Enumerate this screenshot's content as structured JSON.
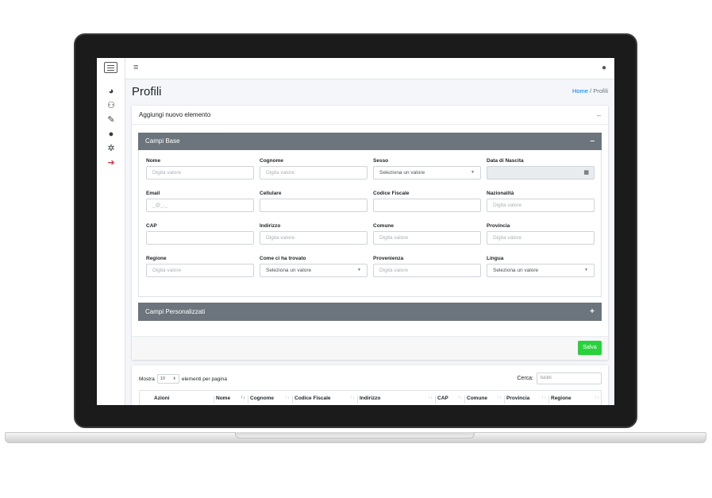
{
  "nav": {
    "menu_icon": "hamburger-icon",
    "chat_icon": "comments-icon",
    "sidebar_icons": [
      "chart-pie-icon",
      "users-icon",
      "edit-icon",
      "comments-icon",
      "cog-icon",
      "sign-out-icon"
    ]
  },
  "page": {
    "title": "Profili",
    "breadcrumb_home": "Home",
    "breadcrumb_sep": "/",
    "breadcrumb_current": "Profili"
  },
  "card": {
    "title": "Aggiungi nuovo elemento",
    "collapse": "–"
  },
  "section_base": {
    "title": "Campi Base",
    "toggle": "–",
    "fields": [
      {
        "label": "Nome",
        "value": "",
        "placeholder": "Digita valore",
        "type": "text"
      },
      {
        "label": "Cognome",
        "value": "",
        "placeholder": "Digita valore",
        "type": "text"
      },
      {
        "label": "Sesso",
        "value": "Seleziona un valore",
        "placeholder": "",
        "type": "select"
      },
      {
        "label": "Data di Nascita",
        "value": "",
        "placeholder": "",
        "type": "date"
      },
      {
        "label": "Email",
        "value": "",
        "placeholder": "_@_._",
        "type": "text"
      },
      {
        "label": "Cellulare",
        "value": "",
        "placeholder": "",
        "type": "text"
      },
      {
        "label": "Codice Fiscale",
        "value": "",
        "placeholder": "",
        "type": "text"
      },
      {
        "label": "Nazionalità",
        "value": "",
        "placeholder": "Digita valore",
        "type": "text"
      },
      {
        "label": "CAP",
        "value": "",
        "placeholder": "",
        "type": "text"
      },
      {
        "label": "Indirizzo",
        "value": "",
        "placeholder": "Digita valore",
        "type": "text"
      },
      {
        "label": "Comune",
        "value": "",
        "placeholder": "Digita valore",
        "type": "text"
      },
      {
        "label": "Provincia",
        "value": "",
        "placeholder": "Digita valore",
        "type": "text"
      },
      {
        "label": "Regione",
        "value": "",
        "placeholder": "Digita valore",
        "type": "text"
      },
      {
        "label": "Come ci ha trovato",
        "value": "Seleziona un valore",
        "placeholder": "",
        "type": "select"
      },
      {
        "label": "Provenienza",
        "value": "",
        "placeholder": "Digita valore",
        "type": "text"
      },
      {
        "label": "Lingua",
        "value": "Seleziona un valore",
        "placeholder": "",
        "type": "select"
      }
    ]
  },
  "section_custom": {
    "title": "Campi Personalizzati",
    "toggle": "+"
  },
  "save_label": "Salva",
  "table": {
    "show_prefix": "Mostra",
    "page_length": "10",
    "show_suffix": "elementi per pagina",
    "search_label": "Cerca:",
    "search_value": "lucini",
    "columns": [
      {
        "label": "Azioni",
        "sort": ""
      },
      {
        "label": "Nome",
        "sort": "↑↓"
      },
      {
        "label": "Cognome",
        "sort": "↑↓"
      },
      {
        "label": "Codice Fiscale",
        "sort": "↑↓"
      },
      {
        "label": "Indirizzo",
        "sort": "↑↓"
      },
      {
        "label": "CAP",
        "sort": "↑↓"
      },
      {
        "label": "Comune",
        "sort": "↑↓"
      },
      {
        "label": "Provincia",
        "sort": "↑↓"
      },
      {
        "label": "Regione",
        "sort": "↑↓"
      }
    ]
  },
  "colors": {
    "section_header": "#6c757d",
    "save_button": "#28d23c",
    "link": "#007bff",
    "logout": "#dc3545"
  }
}
